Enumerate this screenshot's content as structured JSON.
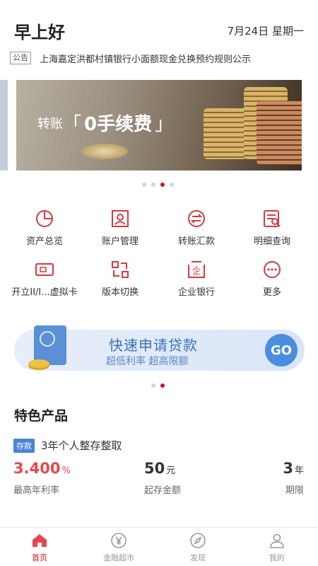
{
  "header": {
    "greeting": "早上好",
    "date": "7月24日 星期一"
  },
  "notice": {
    "tag": "公告",
    "text": "上海嘉定洪都村镇银行小面额现金兑换预约规则公示"
  },
  "banner": {
    "prefix": "转账",
    "highlight": "0手续费",
    "active_slide": 3,
    "slides": 4
  },
  "menu": {
    "items": [
      {
        "label": "资产总览",
        "icon": "pie-chart-icon"
      },
      {
        "label": "账户管理",
        "icon": "user-card-icon"
      },
      {
        "label": "转账汇款",
        "icon": "transfer-icon"
      },
      {
        "label": "明细查询",
        "icon": "search-doc-icon"
      },
      {
        "label": "开立II/I...虚拟卡",
        "icon": "bank-card-icon"
      },
      {
        "label": "版本切换",
        "icon": "switch-icon"
      },
      {
        "label": "企业银行",
        "icon": "enterprise-icon"
      },
      {
        "label": "更多",
        "icon": "more-icon"
      }
    ]
  },
  "loan_banner": {
    "title": "快速申请贷款",
    "subtitle": "超低利率 超高限额",
    "go_label": "GO",
    "active_slide": 2,
    "slides": 2
  },
  "featured": {
    "section_title": "特色产品",
    "tag": "存款",
    "name": "3年个人整存整取",
    "rate_value": "3.400",
    "rate_unit": "%",
    "rate_label": "最高年利率",
    "amount_value": "50",
    "amount_unit": "元",
    "amount_label": "起存金额",
    "term_value": "3",
    "term_unit": "年",
    "term_label": "期限"
  },
  "tabbar": {
    "tabs": [
      {
        "label": "首页",
        "icon": "home-icon",
        "active": true
      },
      {
        "label": "金融超市",
        "icon": "yuan-icon",
        "active": false
      },
      {
        "label": "发现",
        "icon": "compass-icon",
        "active": false
      },
      {
        "label": "我的",
        "icon": "person-icon",
        "active": false
      }
    ]
  },
  "colors": {
    "accent": "#c8161d",
    "icon_red": "#d9383e",
    "loan_blue": "#4b8de0",
    "rate_red": "#e5484d"
  }
}
